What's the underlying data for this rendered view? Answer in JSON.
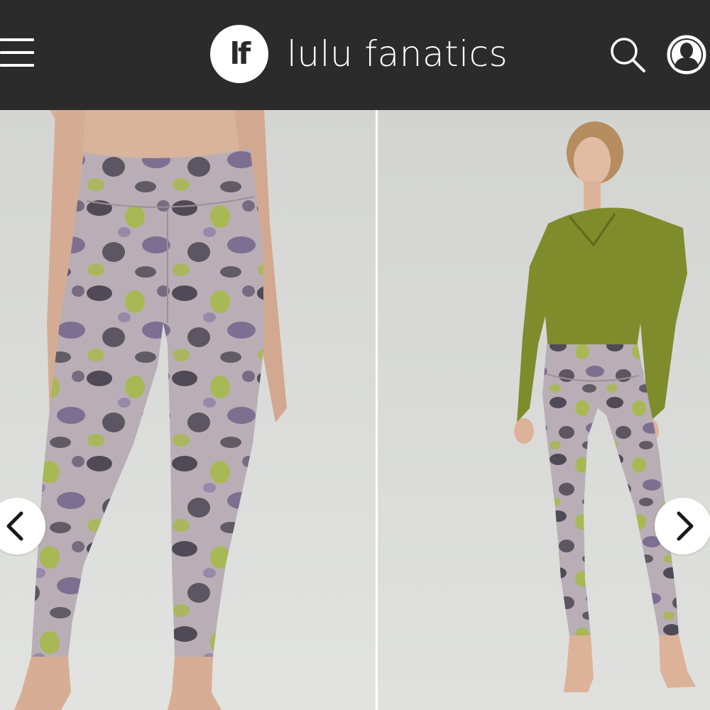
{
  "header": {
    "logo_text": "lf",
    "brand_name": "lulu fanatics",
    "background": "#2b2b2b",
    "icons": [
      "menu-icon",
      "search-icon",
      "user-account-icon"
    ]
  },
  "gallery": {
    "images": [
      {
        "name": "leggings-back-view"
      },
      {
        "name": "leggings-front-view"
      }
    ],
    "controls": [
      "chevron-left-icon",
      "chevron-right-icon"
    ],
    "colors": {
      "leggings_base": "#b9aeb5",
      "print_olive": "#a7b94a",
      "print_purple": "#6e5f88",
      "print_dark": "#3c3845",
      "top_olive": "#7e8c2c",
      "backdrop": "#d9dad8"
    }
  }
}
